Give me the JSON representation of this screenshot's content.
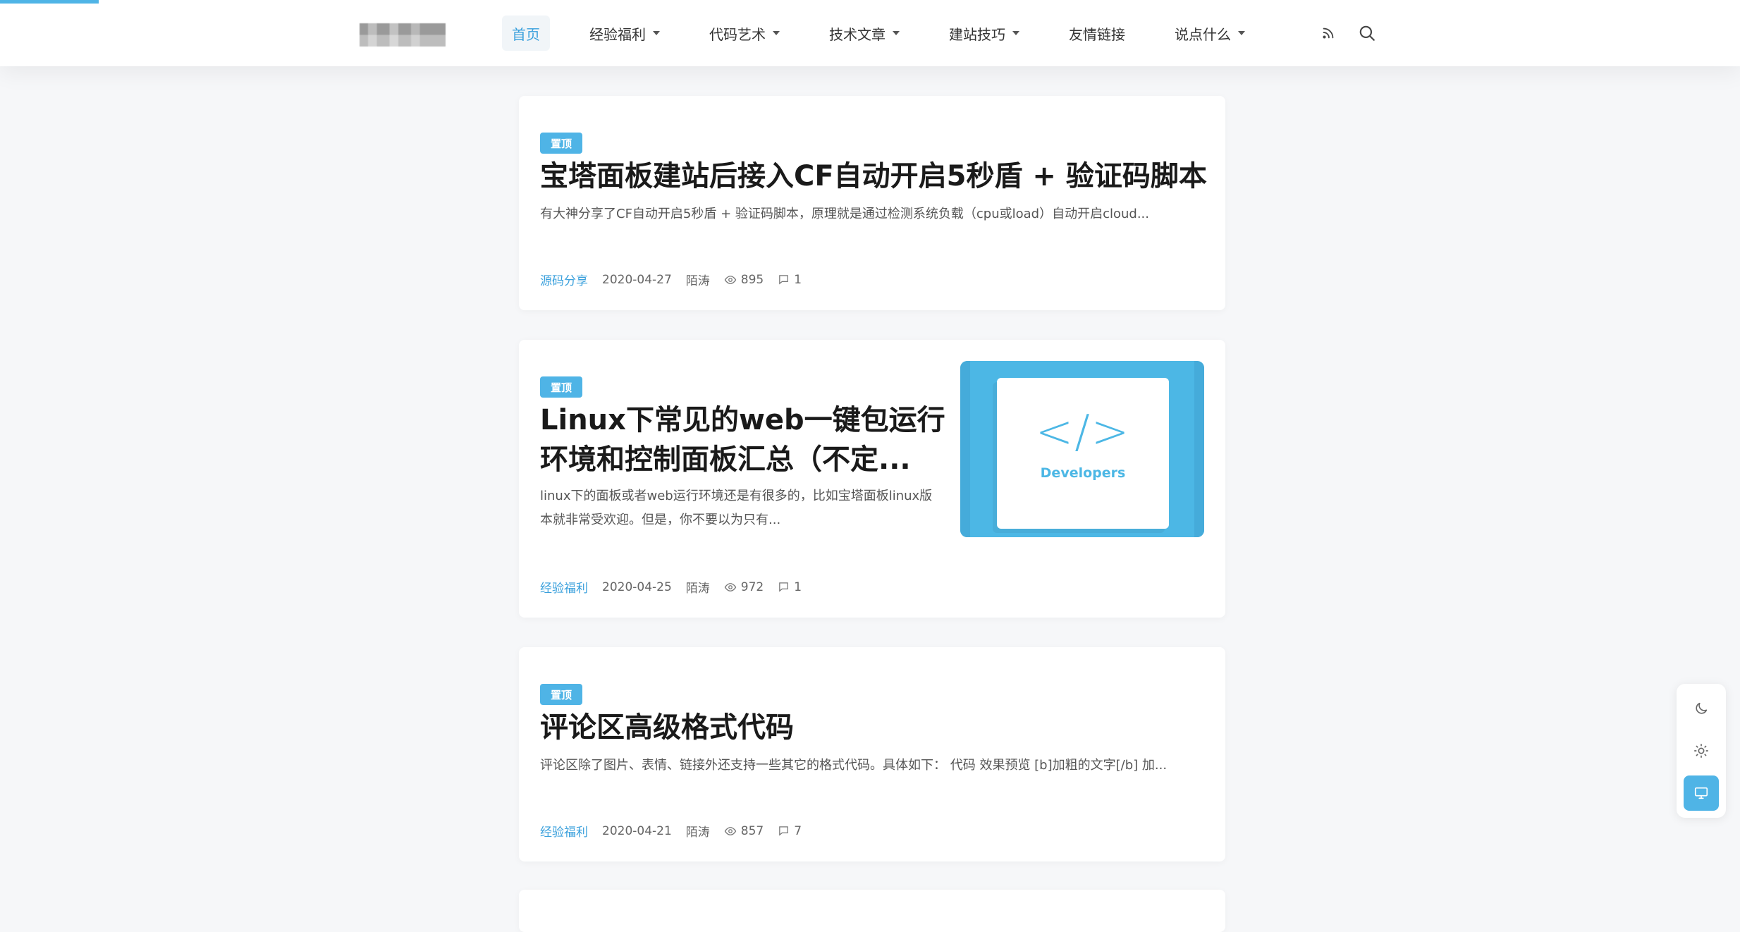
{
  "nav": {
    "items": [
      {
        "label": "首页",
        "active": true,
        "dropdown": false
      },
      {
        "label": "经验福利",
        "active": false,
        "dropdown": true
      },
      {
        "label": "代码艺术",
        "active": false,
        "dropdown": true
      },
      {
        "label": "技术文章",
        "active": false,
        "dropdown": true
      },
      {
        "label": "建站技巧",
        "active": false,
        "dropdown": true
      },
      {
        "label": "友情链接",
        "active": false,
        "dropdown": false
      },
      {
        "label": "说点什么",
        "active": false,
        "dropdown": true
      }
    ],
    "icons": [
      "rss-icon",
      "search-icon"
    ]
  },
  "posts": [
    {
      "badge": "置顶",
      "title": "宝塔面板建站后接入CF自动开启5秒盾 + 验证码脚本",
      "excerpt": "有大神分享了CF自动开启5秒盾 + 验证码脚本，原理就是通过检测系统负载（cpu或load）自动开启cloud...",
      "category": "源码分享",
      "date": "2020-04-27",
      "author": "陌涛",
      "views": "895",
      "comments": "1"
    },
    {
      "badge": "置顶",
      "title": "Linux下常见的web一键包运行环境和控制面板汇总（不定...",
      "excerpt": "linux下的面板或者web运行环境还是有很多的，比如宝塔面板linux版本就非常受欢迎。但是，你不要以为只有...",
      "category": "经验福利",
      "date": "2020-04-25",
      "author": "陌涛",
      "views": "972",
      "comments": "1",
      "thumb": {
        "symbol": "</>",
        "label": "Developers"
      }
    },
    {
      "badge": "置顶",
      "title": "评论区高级格式代码",
      "excerpt": "评论区除了图片、表情、链接外还支持一些其它的格式代码。具体如下：  代码 效果预览 [b]加粗的文字[/b] 加...",
      "category": "经验福利",
      "date": "2020-04-21",
      "author": "陌涛",
      "views": "857",
      "comments": "7"
    }
  ],
  "theme_switcher": {
    "buttons": [
      "moon-icon",
      "sun-icon",
      "monitor-icon"
    ],
    "active": "monitor-icon"
  },
  "colors": {
    "accent": "#4fb4e6",
    "link": "#3aa0dc",
    "background": "#f6f7f9"
  }
}
